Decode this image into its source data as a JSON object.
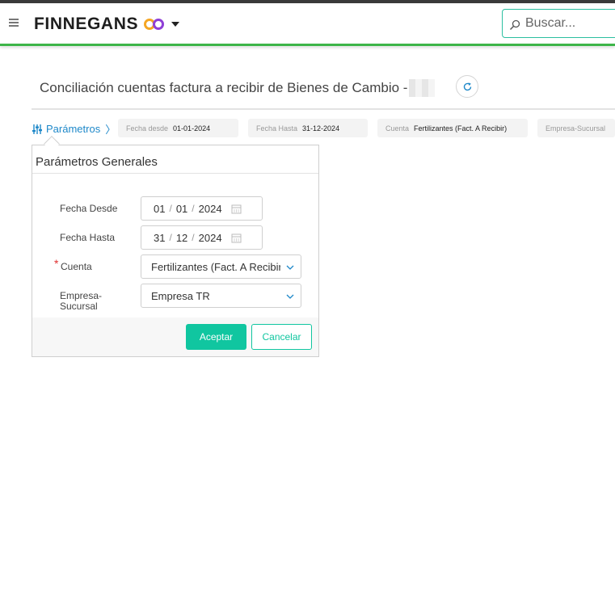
{
  "header": {
    "brand": "FINNEGANS",
    "search_placeholder": "Buscar..."
  },
  "page": {
    "title": "Conciliación cuentas factura a recibir de Bienes de Cambio -"
  },
  "params_bar": {
    "toggle_label": "Parámetros",
    "chips": [
      {
        "label": "Fecha desde",
        "value": "01-01-2024"
      },
      {
        "label": "Fecha Hasta",
        "value": "31-12-2024"
      },
      {
        "label": "Cuenta",
        "value": "Fertilizantes (Fact. A Recibir)"
      },
      {
        "label": "Empresa-Sucursal",
        "value": ""
      }
    ]
  },
  "popover": {
    "title": "Parámetros Generales",
    "fields": {
      "fecha_desde": {
        "label": "Fecha Desde",
        "day": "01",
        "month": "01",
        "year": "2024"
      },
      "fecha_hasta": {
        "label": "Fecha Hasta",
        "day": "31",
        "month": "12",
        "year": "2024"
      },
      "cuenta": {
        "label": "Cuenta",
        "value": "Fertilizantes (Fact. A Recibir)"
      },
      "empresa": {
        "label_line1": "Empresa-",
        "label_line2": "Sucursal",
        "value": "Empresa TR"
      }
    },
    "accept_label": "Aceptar",
    "cancel_label": "Cancelar"
  },
  "colors": {
    "accent": "#10c6a0",
    "header_line": "#3db549",
    "link": "#1e88c9",
    "required": "#e03030"
  }
}
